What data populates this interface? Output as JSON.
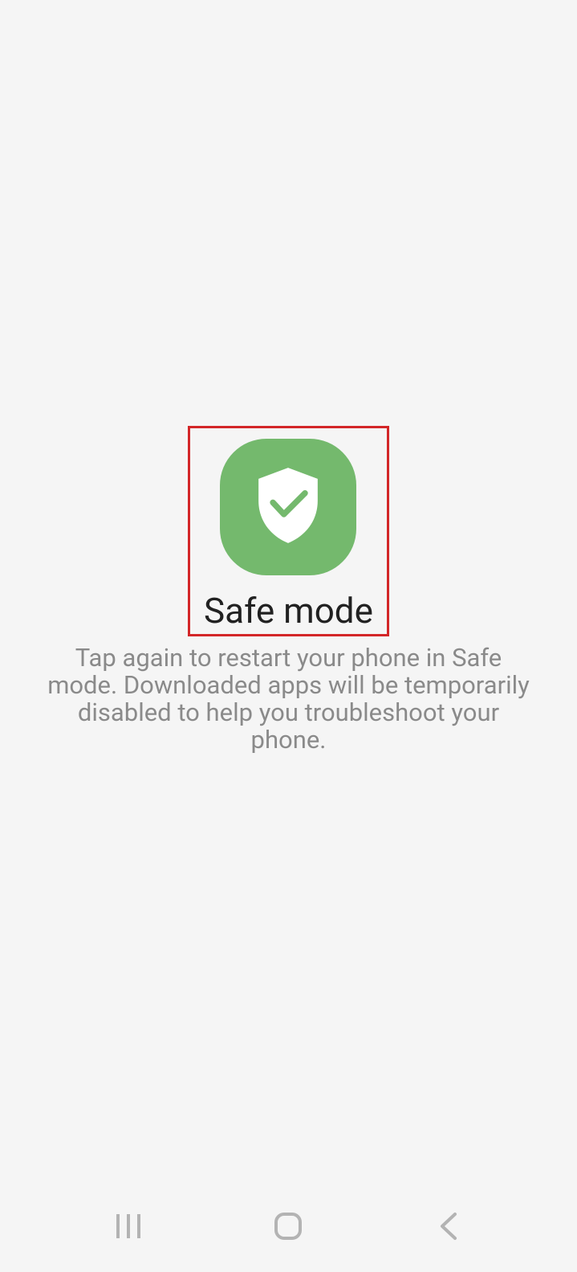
{
  "safeMode": {
    "title": "Safe mode",
    "description": "Tap again to restart your phone in Safe mode. Downloaded apps will be temporarily disabled to help you troubleshoot your phone."
  }
}
